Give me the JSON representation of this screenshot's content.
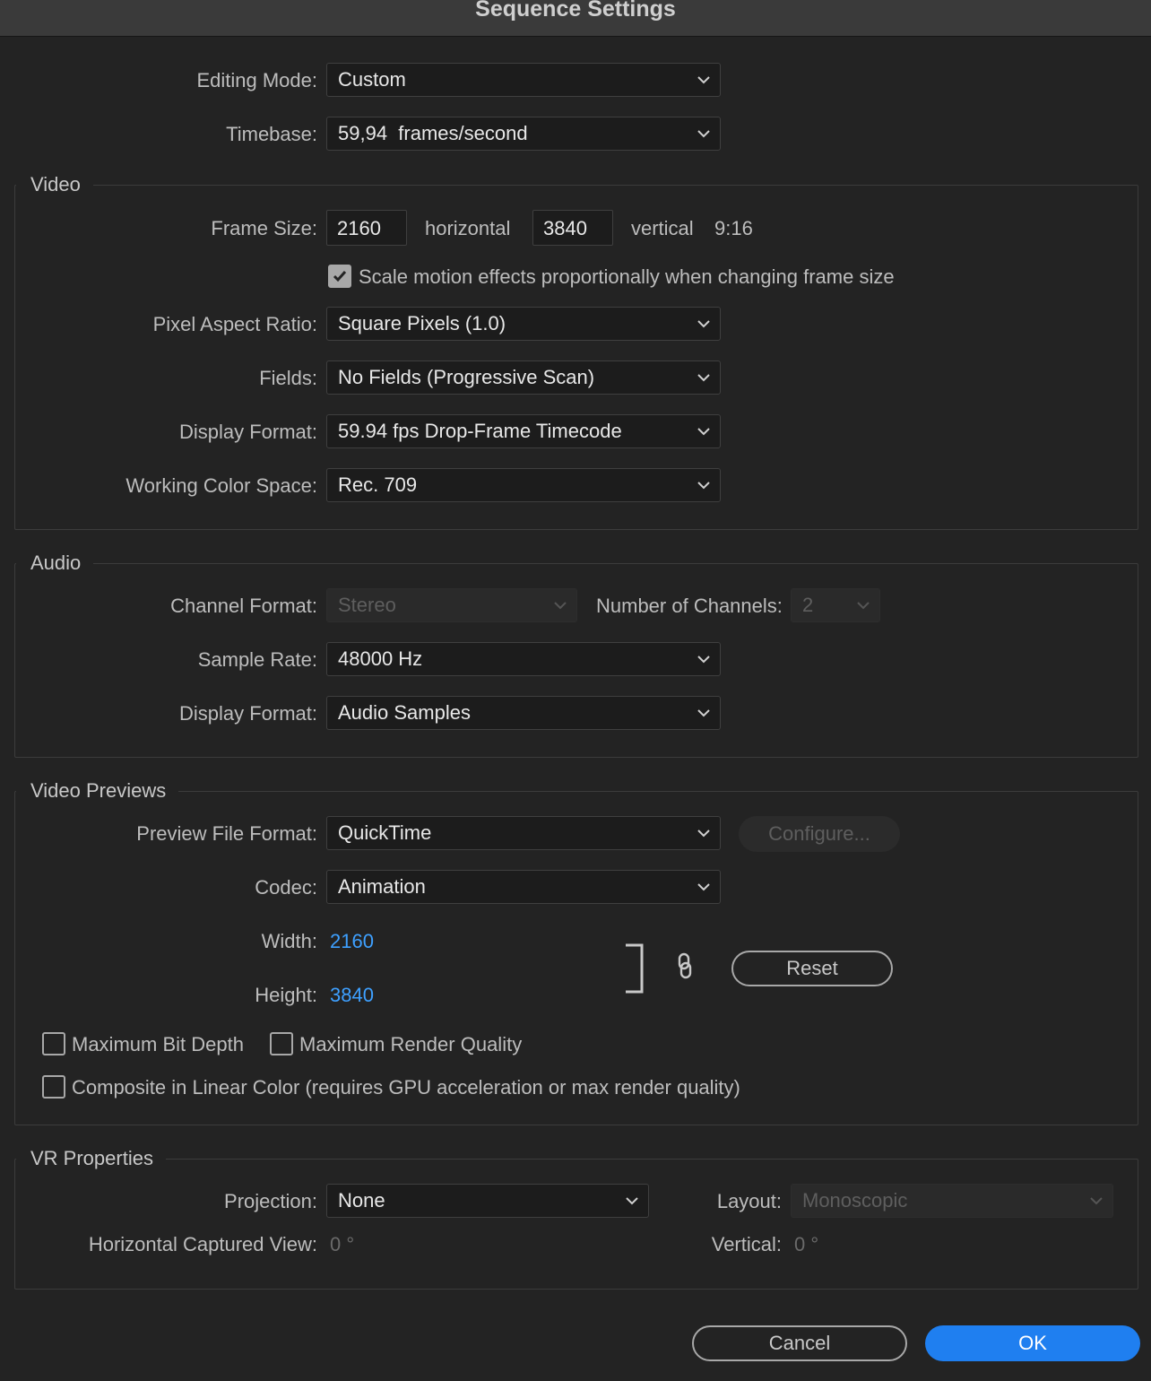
{
  "window": {
    "title": "Sequence Settings"
  },
  "general": {
    "editing_mode": {
      "label": "Editing Mode:",
      "value": "Custom"
    },
    "timebase": {
      "label": "Timebase:",
      "value": "59,94  frames/second"
    }
  },
  "video": {
    "title": "Video",
    "frame_size": {
      "label": "Frame Size:",
      "horizontal_value": "2160",
      "horizontal_label": "horizontal",
      "vertical_value": "3840",
      "vertical_label": "vertical",
      "aspect": "9:16"
    },
    "scale_motion": {
      "label": "Scale motion effects proportionally when changing frame size",
      "checked": true
    },
    "pixel_aspect_ratio": {
      "label": "Pixel Aspect Ratio:",
      "value": "Square Pixels (1.0)"
    },
    "fields": {
      "label": "Fields:",
      "value": "No Fields (Progressive Scan)"
    },
    "display_format": {
      "label": "Display Format:",
      "value": "59.94 fps Drop-Frame Timecode"
    },
    "working_color_space": {
      "label": "Working Color Space:",
      "value": "Rec. 709"
    }
  },
  "audio": {
    "title": "Audio",
    "channel_format": {
      "label": "Channel Format:",
      "value": "Stereo",
      "disabled": true
    },
    "number_of_channels": {
      "label": "Number of Channels:",
      "value": "2",
      "disabled": true
    },
    "sample_rate": {
      "label": "Sample Rate:",
      "value": "48000 Hz"
    },
    "display_format": {
      "label": "Display Format:",
      "value": "Audio Samples"
    }
  },
  "video_previews": {
    "title": "Video Previews",
    "preview_file_format": {
      "label": "Preview File Format:",
      "value": "QuickTime"
    },
    "configure_button": "Configure...",
    "codec": {
      "label": "Codec:",
      "value": "Animation"
    },
    "width": {
      "label": "Width:",
      "value": "2160"
    },
    "height": {
      "label": "Height:",
      "value": "3840"
    },
    "reset_button": "Reset",
    "maximum_bit_depth": {
      "label": "Maximum Bit Depth",
      "checked": false
    },
    "maximum_render_quality": {
      "label": "Maximum Render Quality",
      "checked": false
    },
    "composite_linear": {
      "label": "Composite in Linear Color (requires GPU acceleration or max render quality)",
      "checked": false
    }
  },
  "vr_properties": {
    "title": "VR Properties",
    "projection": {
      "label": "Projection:",
      "value": "None"
    },
    "layout": {
      "label": "Layout:",
      "value": "Monoscopic",
      "disabled": true
    },
    "horizontal_captured_view": {
      "label": "Horizontal Captured View:",
      "value": "0 °"
    },
    "vertical": {
      "label": "Vertical:",
      "value": "0 °"
    }
  },
  "footer": {
    "cancel": "Cancel",
    "ok": "OK"
  },
  "colors": {
    "accent": "#1f7ff0",
    "link_value": "#3ea0ff",
    "background": "#232323"
  }
}
